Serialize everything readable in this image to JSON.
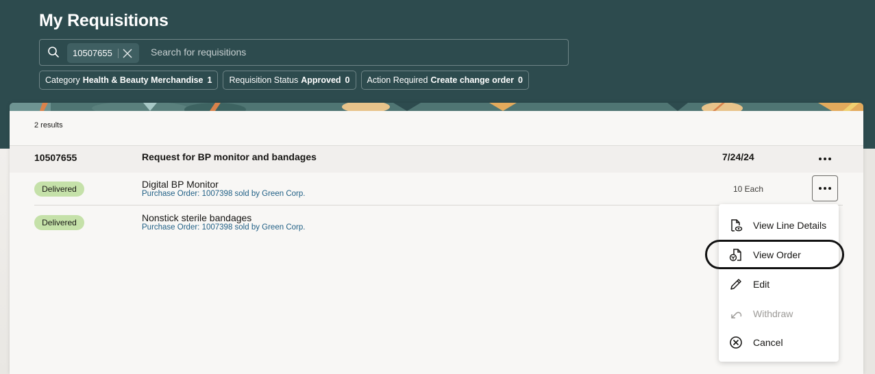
{
  "header": {
    "title": "My Requisitions",
    "search": {
      "chip_value": "10507655",
      "placeholder": "Search for requisitions"
    },
    "filters": [
      {
        "label": "Category",
        "value": "Health & Beauty Merchandise",
        "count": "1"
      },
      {
        "label": "Requisition Status",
        "value": "Approved",
        "count": "0"
      },
      {
        "label": "Action Required",
        "value": "Create change order",
        "count": "0"
      }
    ]
  },
  "results": {
    "count_text": "2 results",
    "requisition": {
      "id": "10507655",
      "title": "Request for BP monitor and bandages",
      "date": "7/24/24"
    },
    "lines": [
      {
        "status": "Delivered",
        "name": "Digital BP Monitor",
        "po": "Purchase Order: 1007398 sold by Green Corp.",
        "qty": "10 Each"
      },
      {
        "status": "Delivered",
        "name": "Nonstick sterile bandages",
        "po": "Purchase Order: 1007398 sold by Green Corp.",
        "qty": ""
      }
    ]
  },
  "menu": {
    "items": [
      {
        "label": "View Line Details",
        "icon": "document-eye-icon",
        "disabled": false
      },
      {
        "label": "View Order",
        "icon": "document-box-icon",
        "disabled": false,
        "highlighted": true
      },
      {
        "label": "Edit",
        "icon": "pencil-icon",
        "disabled": false
      },
      {
        "label": "Withdraw",
        "icon": "undo-arrow-icon",
        "disabled": true
      },
      {
        "label": "Cancel",
        "icon": "circle-x-icon",
        "disabled": false
      }
    ]
  },
  "colors": {
    "header_bg": "#2d4b4e",
    "status_delivered": "#c5e1a9",
    "link": "#1f5f85"
  }
}
